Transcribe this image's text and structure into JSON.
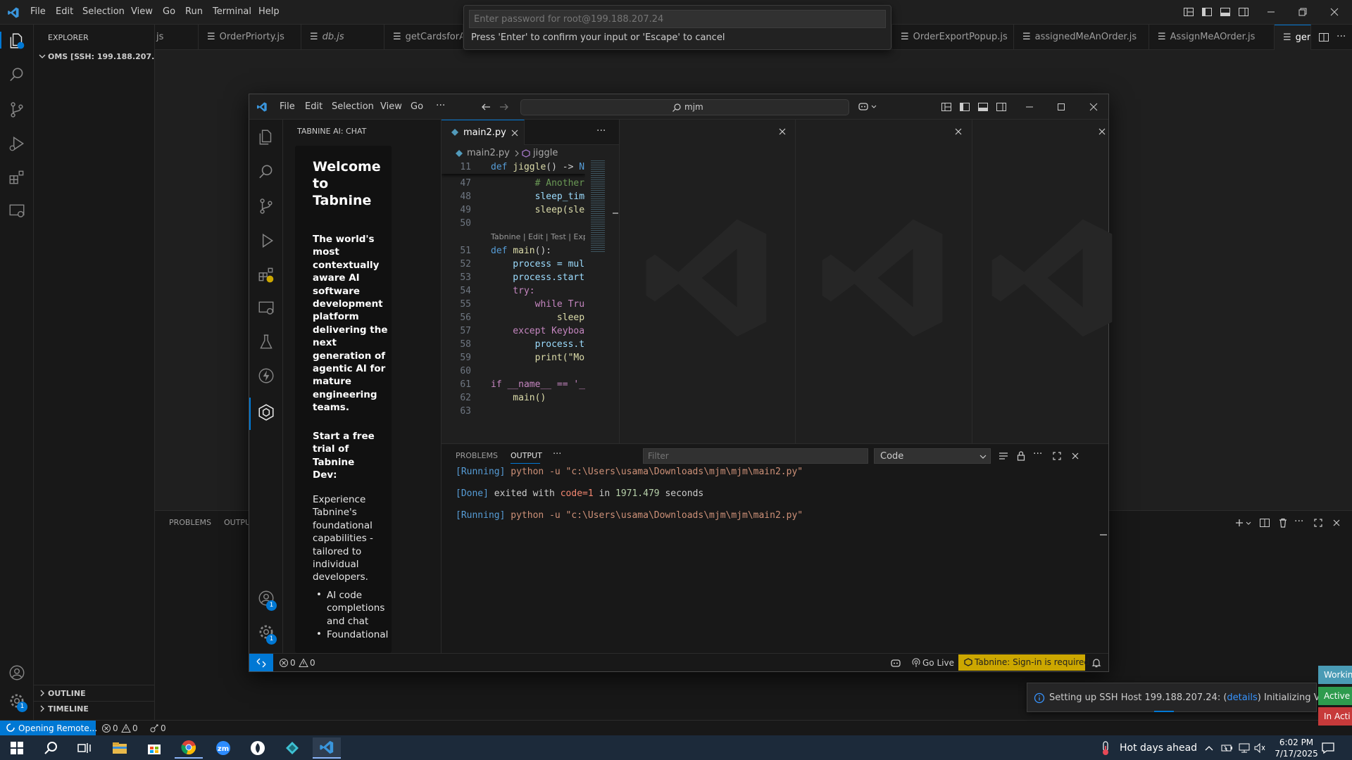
{
  "outer": {
    "menu": [
      "File",
      "Edit",
      "Selection",
      "View",
      "Go",
      "Run",
      "Terminal",
      "Help"
    ],
    "explorer_title": "EXPLORER",
    "workspace": "OMS [SSH: 199.188.207.24]",
    "outline": "OUTLINE",
    "timeline": "TIMELINE",
    "tabs": [
      "js",
      "OrderPriorty.js",
      "db.js",
      "getCardsforAdr",
      "OrderExportPopup.js",
      "assignedMeAnOrder.js",
      "AssignMeAOrder.js",
      "ger"
    ],
    "panel_tabs": [
      "PROBLEMS",
      "OUTPU"
    ],
    "status": {
      "remote": "Opening Remote...",
      "errors": "0",
      "warnings": "0",
      "ports": "0"
    },
    "settings_badge": "1"
  },
  "quick_input": {
    "placeholder": "Enter password for root@199.188.207.24",
    "hint": "Press 'Enter' to confirm your input or 'Escape' to cancel"
  },
  "inner": {
    "menu": [
      "File",
      "Edit",
      "Selection",
      "View",
      "Go",
      "···"
    ],
    "search": "mjm",
    "side_title": "TABNINE AI: CHAT",
    "tab": "main2.py",
    "breadcrumb": [
      "main2.py",
      "jiggle"
    ],
    "codelens": "Tabnine | Edit | Test | Explai",
    "welcome": {
      "heading": "Welcome to Tabnine",
      "tagline": "The world's most contextually aware AI software development platform delivering the next generation of agentic AI for mature engineering teams.",
      "trial": "Start a free trial of Tabnine Dev:",
      "body": "Experience Tabnine's foundational capabilities - tailored to individual developers.",
      "bullets": [
        "AI code completions and chat",
        "Foundational"
      ]
    },
    "code": [
      {
        "ln": "11",
        "text": "def jiggle() -> No"
      },
      {
        "ln": "47",
        "text": "        # Another"
      },
      {
        "ln": "48",
        "text": "        sleep_time"
      },
      {
        "ln": "49",
        "text": "        sleep(slee"
      },
      {
        "ln": "50",
        "text": ""
      },
      {
        "ln": "51",
        "text": "def main():"
      },
      {
        "ln": "52",
        "text": "    process = mult"
      },
      {
        "ln": "53",
        "text": "    process.start("
      },
      {
        "ln": "54",
        "text": "    try:"
      },
      {
        "ln": "55",
        "text": "        while True"
      },
      {
        "ln": "56",
        "text": "            sleep("
      },
      {
        "ln": "57",
        "text": "    except Keyboar"
      },
      {
        "ln": "58",
        "text": "        process.te"
      },
      {
        "ln": "59",
        "text": "        print(\"Mou"
      },
      {
        "ln": "60",
        "text": ""
      },
      {
        "ln": "61",
        "text": "if __name__ == '__"
      },
      {
        "ln": "62",
        "text": "    main()"
      },
      {
        "ln": "63",
        "text": ""
      }
    ],
    "panel_tabs": [
      "PROBLEMS",
      "OUTPUT",
      "···"
    ],
    "filter_placeholder": "Filter",
    "output_channel": "Code",
    "output": {
      "l1_tag": "[Running]",
      "l1_cmd": " python -u \"c:\\Users\\usama\\Downloads\\mjm\\mjm\\main2.py\"",
      "l2_tag": "[Done]",
      "l2_a": " exited with ",
      "l2_code": "code=1",
      "l2_b": " in ",
      "l2_num": "1971.479",
      "l2_c": " seconds",
      "l3_tag": "[Running]",
      "l3_cmd": " python -u \"c:\\Users\\usama\\Downloads\\mjm\\mjm\\main2.py\""
    },
    "status": {
      "errors": "0",
      "warnings": "0",
      "golive": "Go Live",
      "tabnine": "Tabnine: Sign-in is required"
    },
    "account_badge": "1",
    "settings_badge": "1"
  },
  "notification": {
    "text_a": "Setting up SSH Host 199.188.207.24: (",
    "link": "details",
    "text_b": ") Initializing VS Code"
  },
  "side_badges": [
    {
      "label": "Workin",
      "color": "#4a9bb5"
    },
    {
      "label": "Active",
      "color": "#2e9b4e"
    },
    {
      "label": "In Acti",
      "color": "#c73a3a"
    }
  ],
  "taskbar": {
    "weather": "Hot days ahead",
    "time": "6:02 PM",
    "date": "7/17/2025"
  }
}
